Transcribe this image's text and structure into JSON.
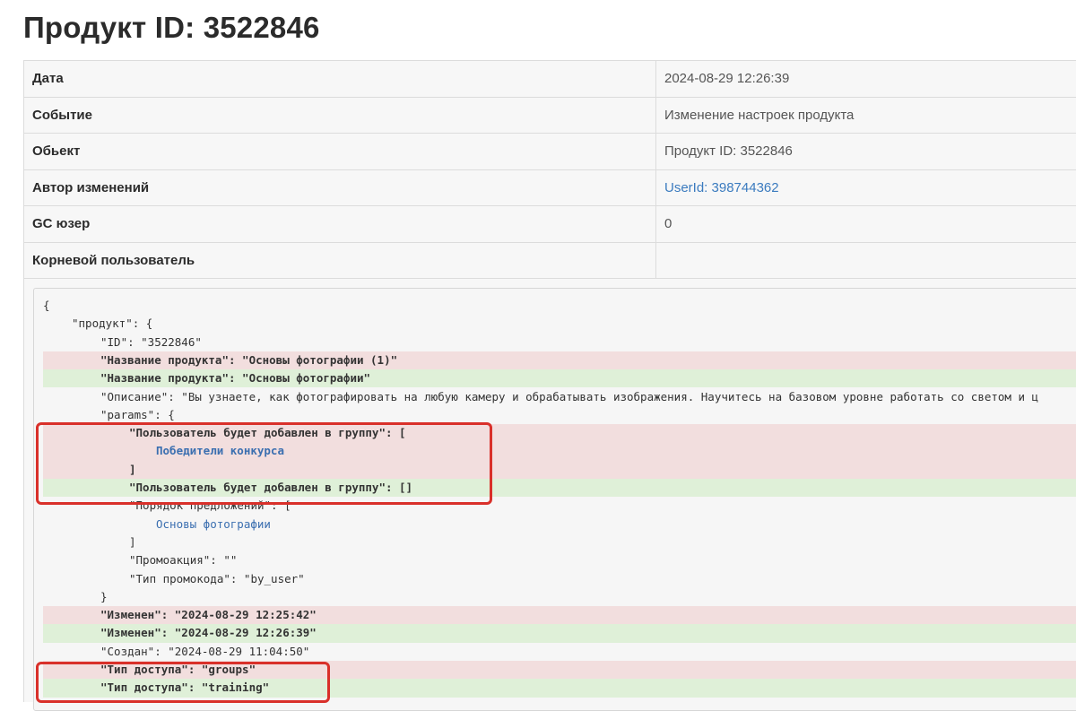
{
  "page_title": "Продукт ID: 3522846",
  "rows": [
    {
      "key": "Дата",
      "value": "2024-08-29 12:26:39"
    },
    {
      "key": "Событие",
      "value": "Изменение настроек продукта"
    },
    {
      "key": "Обьект",
      "value": "Продукт ID: 3522846"
    },
    {
      "key": "Автор изменений",
      "value": "UserId: 398744362"
    },
    {
      "key": "GC юзер",
      "value": "0"
    },
    {
      "key": "Корневой пользователь",
      "value": ""
    }
  ],
  "diff_lines": [
    "{",
    "\"продукт\": {",
    "\"ID\": \"3522846\"",
    "\"Название продукта\": \"Основы фотографии (1)\"",
    "\"Название продукта\": \"Основы фотографии\"",
    "\"Описание\": \"Вы узнаете, как фотографировать на любую камеру и обрабатывать изображения. Научитесь на базовом уровне работать со светом и ц",
    "\"params\": {",
    "\"Пользователь будет добавлен в группу\": [",
    "Победители конкурса",
    "]",
    "\"Пользователь будет добавлен в группу\": []",
    "\"Порядок предложений\": [",
    "Основы фотографии",
    "]",
    "\"Промоакция\": \"\"",
    "\"Тип промокода\": \"by_user\"",
    "}",
    "\"Изменен\": \"2024-08-29 12:25:42\"",
    "\"Изменен\": \"2024-08-29 12:26:39\"",
    "\"Создан\": \"2024-08-29 11:04:50\"",
    "\"Тип доступа\": \"groups\"",
    "\"Тип доступа\": \"training\""
  ],
  "colors": {
    "removed_bg": "#f2dede",
    "added_bg": "#dff0d8",
    "highlight": "#d9302a",
    "link": "#3b7bbf"
  }
}
